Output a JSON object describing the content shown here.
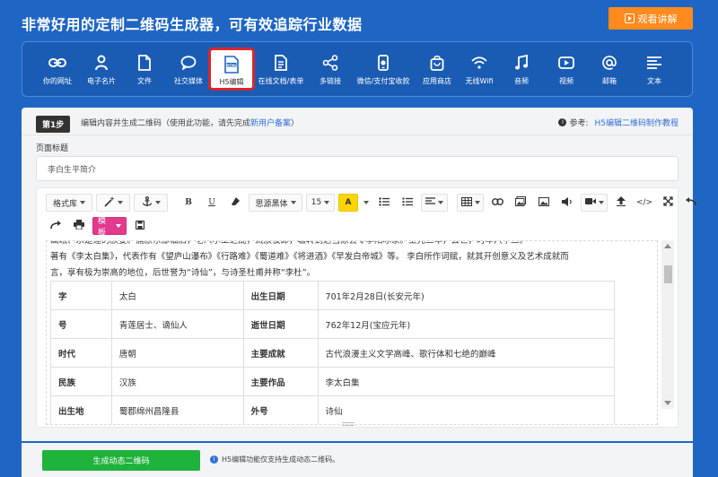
{
  "header": {
    "title": "非常好用的定制二维码生成器，可有效追踪行业数据",
    "watch_button": "观看讲解"
  },
  "toolbar": {
    "items": [
      {
        "label": "你的网址",
        "icon": "link-icon"
      },
      {
        "label": "电子名片",
        "icon": "person-icon"
      },
      {
        "label": "文件",
        "icon": "file-icon"
      },
      {
        "label": "社交媒体",
        "icon": "chat-bubble-icon"
      },
      {
        "label": "H5编辑",
        "icon": "html-file-icon",
        "active": true
      },
      {
        "label": "在线文档/表单",
        "icon": "document-icon"
      },
      {
        "label": "多链接",
        "icon": "share-icon"
      },
      {
        "label": "微信/支付宝收款",
        "icon": "phone-payment-icon"
      },
      {
        "label": "应用商店",
        "icon": "store-bag-icon"
      },
      {
        "label": "无线Wifi",
        "icon": "wifi-icon"
      },
      {
        "label": "音频",
        "icon": "music-note-icon"
      },
      {
        "label": "视频",
        "icon": "video-play-icon"
      },
      {
        "label": "邮箱",
        "icon": "at-sign-icon"
      },
      {
        "label": "文本",
        "icon": "text-lines-icon"
      }
    ]
  },
  "step": {
    "badge": "第1步",
    "text": "编辑内容并生成二维码（使用此功能，请先完成",
    "link": "新用户备案",
    "text_end": "）",
    "ref_label": "参考:",
    "ref_link": "H5编辑二维码制作教程"
  },
  "page_title": {
    "label": "页面标题",
    "value": "李白生平简介"
  },
  "editor_toolbar": {
    "format_lib": "格式库",
    "font": "思源黑体",
    "size": "15",
    "bold": "B",
    "underline": "U",
    "highlight": "A",
    "code": "</>",
    "template": "模板"
  },
  "content": {
    "line_cut": "画峨、宗是蓬的族姿。蒲原东部临后，老八尔工之乱，流放夜郎，辗转到达当涂县令李阳冰家。上元二年，去世，时年六十二。",
    "line2": "著有《李太白集》，代表作有《望庐山瀑布》《行路难》《蜀道难》《将进酒》《早发白帝城》等。 李白所作词赋，就其开创意义及艺术成就而",
    "line3": "言，享有极为崇高的地位，后世誉为“诗仙”，与诗圣杜甫并称“李杜”。",
    "table": [
      [
        "字",
        "太白",
        "出生日期",
        "701年2月28日(长安元年)"
      ],
      [
        "号",
        "青莲居士、谪仙人",
        "逝世日期",
        "762年12月(宝应元年)"
      ],
      [
        "时代",
        "唐朝",
        "主要成就",
        "古代浪漫主义文学高峰、歌行体和七绝的巅峰"
      ],
      [
        "民族",
        "汉族",
        "主要作品",
        "李太白集"
      ],
      [
        "出生地",
        "蜀郡绵州昌隆县",
        "外号",
        "诗仙"
      ]
    ]
  },
  "generate": {
    "button": "生成动态二维码",
    "note": "H5编辑功能仅支持生成动态二维码。"
  }
}
